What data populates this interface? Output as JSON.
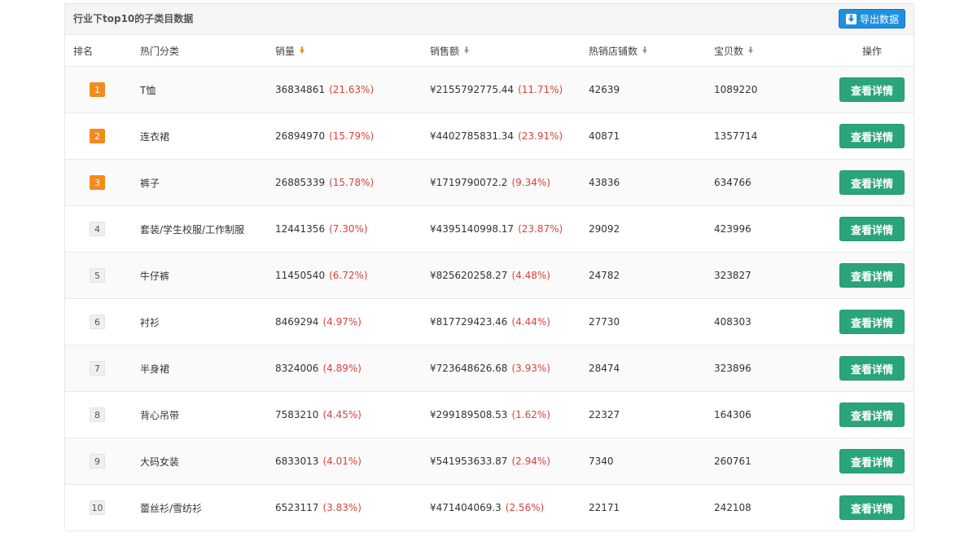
{
  "panel": {
    "title": "行业下top10的子类目数据",
    "export_label": "导出数据"
  },
  "columns": {
    "rank": "排名",
    "category": "热门分类",
    "volume": "销量",
    "amount": "销售额",
    "shops": "热销店铺数",
    "items": "宝贝数",
    "action": "操作"
  },
  "detail_label": "查看详情",
  "colors": {
    "accent_orange": "#f38b1f",
    "detail_green": "#2aa57a",
    "export_blue": "#1f8fe0",
    "pct_red": "#d9423f"
  },
  "rows": [
    {
      "rank": "1",
      "category": "T恤",
      "volume": "36834861",
      "volume_pct": "(21.63%)",
      "amount": "¥2155792775.44",
      "amount_pct": "(11.71%)",
      "shops": "42639",
      "items": "1089220"
    },
    {
      "rank": "2",
      "category": "连衣裙",
      "volume": "26894970",
      "volume_pct": "(15.79%)",
      "amount": "¥4402785831.34",
      "amount_pct": "(23.91%)",
      "shops": "40871",
      "items": "1357714"
    },
    {
      "rank": "3",
      "category": "裤子",
      "volume": "26885339",
      "volume_pct": "(15.78%)",
      "amount": "¥1719790072.2",
      "amount_pct": "(9.34%)",
      "shops": "43836",
      "items": "634766"
    },
    {
      "rank": "4",
      "category": "套装/学生校服/工作制服",
      "volume": "12441356",
      "volume_pct": "(7.30%)",
      "amount": "¥4395140998.17",
      "amount_pct": "(23.87%)",
      "shops": "29092",
      "items": "423996"
    },
    {
      "rank": "5",
      "category": "牛仔裤",
      "volume": "11450540",
      "volume_pct": "(6.72%)",
      "amount": "¥825620258.27",
      "amount_pct": "(4.48%)",
      "shops": "24782",
      "items": "323827"
    },
    {
      "rank": "6",
      "category": "衬衫",
      "volume": "8469294",
      "volume_pct": "(4.97%)",
      "amount": "¥817729423.46",
      "amount_pct": "(4.44%)",
      "shops": "27730",
      "items": "408303"
    },
    {
      "rank": "7",
      "category": "半身裙",
      "volume": "8324006",
      "volume_pct": "(4.89%)",
      "amount": "¥723648626.68",
      "amount_pct": "(3.93%)",
      "shops": "28474",
      "items": "323896"
    },
    {
      "rank": "8",
      "category": "背心吊带",
      "volume": "7583210",
      "volume_pct": "(4.45%)",
      "amount": "¥299189508.53",
      "amount_pct": "(1.62%)",
      "shops": "22327",
      "items": "164306"
    },
    {
      "rank": "9",
      "category": "大码女装",
      "volume": "6833013",
      "volume_pct": "(4.01%)",
      "amount": "¥541953633.87",
      "amount_pct": "(2.94%)",
      "shops": "7340",
      "items": "260761"
    },
    {
      "rank": "10",
      "category": "蕾丝衫/雪纺衫",
      "volume": "6523117",
      "volume_pct": "(3.83%)",
      "amount": "¥471404069.3",
      "amount_pct": "(2.56%)",
      "shops": "22171",
      "items": "242108"
    }
  ]
}
